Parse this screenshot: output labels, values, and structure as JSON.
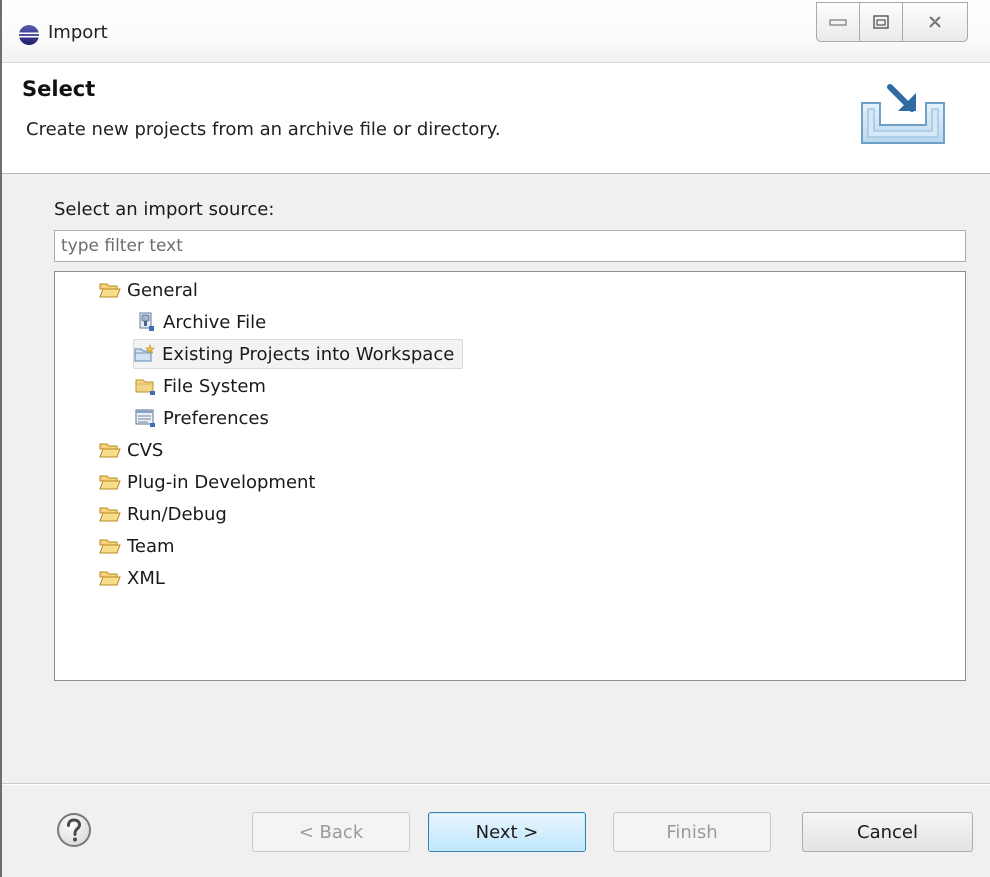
{
  "window": {
    "title": "Import"
  },
  "banner": {
    "title": "Select",
    "description": "Create new projects from an archive file or directory."
  },
  "source": {
    "label": "Select an import source:",
    "filter_placeholder": "type filter text"
  },
  "tree": {
    "items": [
      {
        "label": "General",
        "icon": "folder-open-icon",
        "depth": 0
      },
      {
        "label": "Archive File",
        "icon": "archive-file-icon",
        "depth": 1
      },
      {
        "label": "Existing Projects into Workspace",
        "icon": "existing-project-icon",
        "depth": 1,
        "selected": true
      },
      {
        "label": "File System",
        "icon": "folder-icon",
        "depth": 1
      },
      {
        "label": "Preferences",
        "icon": "preferences-icon",
        "depth": 1
      },
      {
        "label": "CVS",
        "icon": "folder-open-icon",
        "depth": 0
      },
      {
        "label": "Plug-in Development",
        "icon": "folder-open-icon",
        "depth": 0
      },
      {
        "label": "Run/Debug",
        "icon": "folder-open-icon",
        "depth": 0
      },
      {
        "label": "Team",
        "icon": "folder-open-icon",
        "depth": 0
      },
      {
        "label": "XML",
        "icon": "folder-open-icon",
        "depth": 0
      }
    ]
  },
  "buttons": {
    "back": "< Back",
    "next": "Next >",
    "finish": "Finish",
    "cancel": "Cancel"
  },
  "colors": {
    "folder": "#e8b64a",
    "accent": "#3c7fb1",
    "disabled_text": "#9a9a9a"
  }
}
